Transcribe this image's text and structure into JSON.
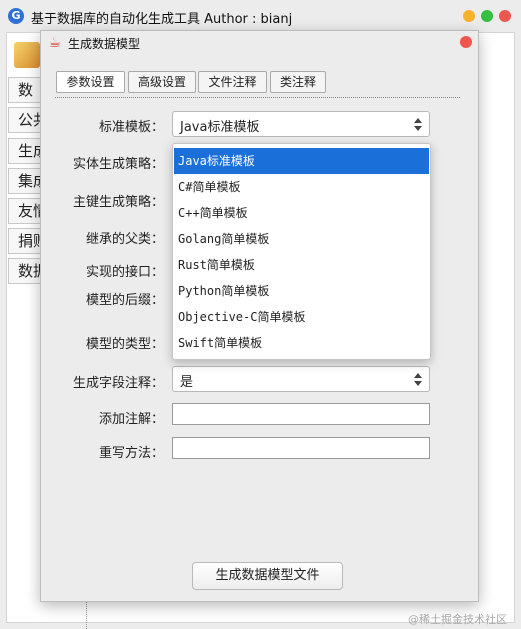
{
  "window": {
    "title": "基于数据库的自动化生成工具  Author : bianj",
    "logo_glyph": "G"
  },
  "main": {
    "nav": [
      "数",
      "公共",
      "生成",
      "集成",
      "友情",
      "捐赠",
      "数据"
    ]
  },
  "dialog": {
    "title": "生成数据模型",
    "tabs": [
      "参数设置",
      "高级设置",
      "文件注释",
      "类注释"
    ],
    "fields": {
      "template_label": "标准模板：",
      "template_value": "Java标准模板",
      "entity_strategy_label": "实体生成策略：",
      "pk_strategy_label": "主键生成策略：",
      "parent_class_label": "继承的父类：",
      "interface_label": "实现的接口：",
      "suffix_label": "模型的后缀：",
      "model_type_label": "模型的类型：",
      "field_comment_label": "生成字段注释：",
      "field_comment_value": "是",
      "annotation_label": "添加注解：",
      "annotation_value": "",
      "override_label": "重写方法：",
      "override_value": ""
    },
    "template_options": [
      "Java标准模板",
      "C#简单模板",
      "C++简单模板",
      "Golang简单模板",
      "Rust简单模板",
      "Python简单模板",
      "Objective-C简单模板",
      "Swift简单模板"
    ],
    "selected_option_index": 0,
    "generate_button": "生成数据模型文件"
  },
  "watermark": "@稀土掘金技术社区",
  "colors": {
    "selection": "#1a70d8",
    "close": "#f0554e",
    "minimize": "#f6b229",
    "maximize": "#34c03e"
  }
}
